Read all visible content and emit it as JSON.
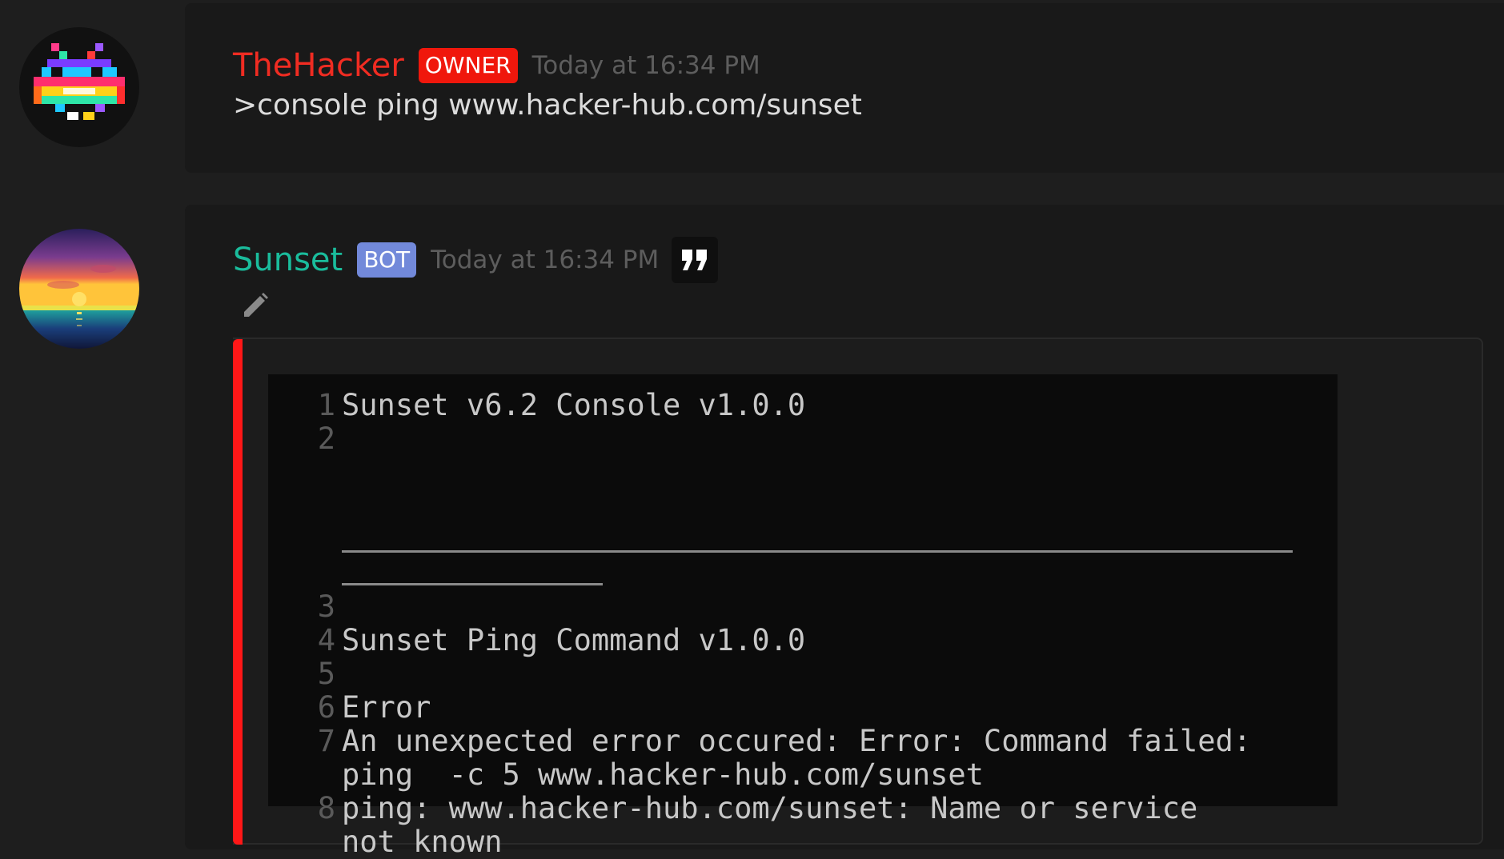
{
  "messages": [
    {
      "author": "TheHacker",
      "author_color": "#f02c22",
      "tag": "OWNER",
      "tag_color": "#f0170c",
      "timestamp": "Today at 16:34 PM",
      "content": ">console ping www.hacker-hub.com/sunset",
      "avatar_icon": "space-invader-avatar"
    },
    {
      "author": "Sunset",
      "author_color": "#1abc9c",
      "tag": "BOT",
      "tag_color": "#7289da",
      "timestamp": "Today at 16:34 PM",
      "avatar_icon": "sunset-avatar",
      "actions": [
        "quote-icon",
        "pencil-icon"
      ],
      "embed": {
        "accent_color": "#ff1717",
        "code_lines": [
          {
            "num": "1",
            "text": "Sunset v6.2 Console v1.0.0"
          },
          {
            "num": "2",
            "text": ""
          },
          {
            "num": "3",
            "text": ""
          },
          {
            "num": "4",
            "text": "Sunset Ping Command v1.0.0"
          },
          {
            "num": "5",
            "text": ""
          },
          {
            "num": "6",
            "text": "Error"
          },
          {
            "num": "7",
            "text": "An unexpected error occured: Error: Command failed:",
            "cont": "ping  -c 5 www.hacker-hub.com/sunset"
          },
          {
            "num": "8",
            "text": "ping: www.hacker-hub.com/sunset: Name or service",
            "cont": "not known"
          }
        ]
      }
    }
  ]
}
